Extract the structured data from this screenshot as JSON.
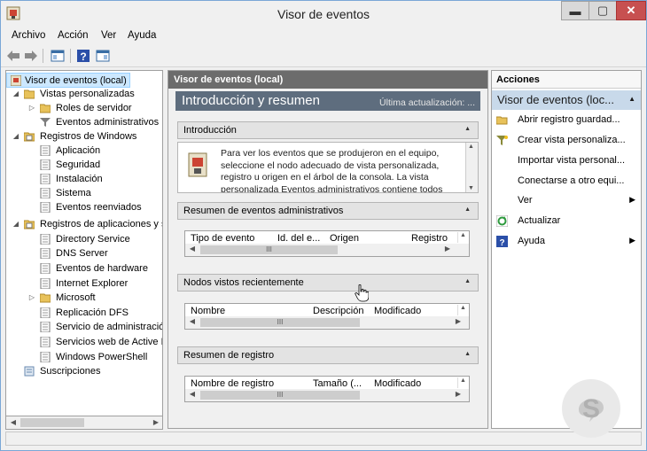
{
  "window": {
    "title": "Visor de eventos",
    "min": "▬",
    "max": "▢",
    "close": "✕"
  },
  "menu": [
    "Archivo",
    "Acción",
    "Ver",
    "Ayuda"
  ],
  "tree": {
    "root": "Visor de eventos (local)",
    "vistas": "Vistas personalizadas",
    "roles": "Roles de servidor",
    "eventos_admin": "Eventos administrativos",
    "registros_windows": "Registros de Windows",
    "aplicacion": "Aplicación",
    "seguridad": "Seguridad",
    "instalacion": "Instalación",
    "sistema": "Sistema",
    "reenviados": "Eventos reenviados",
    "registros_apps": "Registros de aplicaciones y s",
    "directory": "Directory Service",
    "dns": "DNS Server",
    "hardware": "Eventos de hardware",
    "ie": "Internet Explorer",
    "microsoft": "Microsoft",
    "dfs": "Replicación DFS",
    "servicio_admin": "Servicio de administració",
    "servicios_web": "Servicios web de Active D",
    "powershell": "Windows PowerShell",
    "suscripciones": "Suscripciones"
  },
  "center": {
    "header": "Visor de eventos (local)",
    "banner_title": "Introducción y resumen",
    "banner_update": "Última actualización: ...",
    "intro_title": "Introducción",
    "intro_text": "Para ver los eventos que se produjeron en el equipo, seleccione el nodo adecuado de vista personalizada, registro u origen en el árbol de la consola. La vista personalizada Eventos administrativos contiene todos",
    "resumen_admin": {
      "title": "Resumen de eventos administrativos",
      "cols": [
        "Tipo de evento",
        "Id. del e...",
        "Origen",
        "Registro"
      ]
    },
    "nodos": {
      "title": "Nodos vistos recientemente",
      "cols": [
        "Nombre",
        "Descripción",
        "Modificado"
      ]
    },
    "resumen_registro": {
      "title": "Resumen de registro",
      "cols": [
        "Nombre de registro",
        "Tamaño (...",
        "Modificado"
      ]
    },
    "thumb_glyph": "III"
  },
  "actions": {
    "header": "Acciones",
    "sub_header": "Visor de eventos (loc...",
    "items": [
      "Abrir registro guardad...",
      "Crear vista personaliza...",
      "Importar vista personal...",
      "Conectarse a otro equi...",
      "Ver",
      "Actualizar",
      "Ayuda"
    ]
  }
}
